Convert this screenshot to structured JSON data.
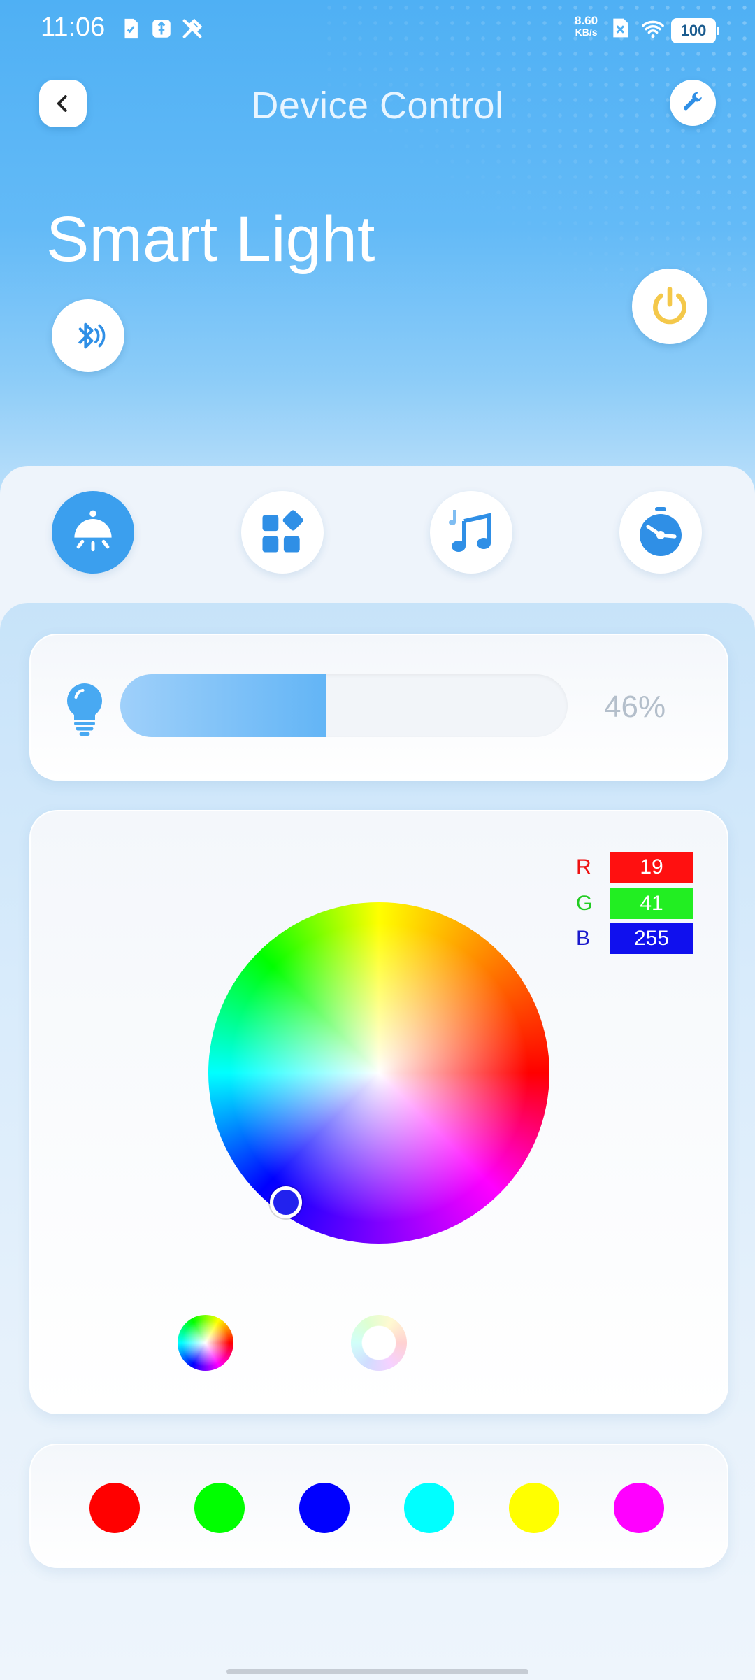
{
  "status_bar": {
    "time": "11:06",
    "net_speed_value": "8.60",
    "net_speed_unit": "KB/s",
    "battery": "100"
  },
  "header": {
    "title": "Device Control"
  },
  "device": {
    "name": "Smart Light"
  },
  "brightness": {
    "value": 46,
    "label": "46%"
  },
  "rgb": {
    "r_label": "R",
    "r_value": "19",
    "g_label": "G",
    "g_value": "41",
    "b_label": "B",
    "b_value": "255"
  },
  "presets": [
    "#ff0000",
    "#00ff00",
    "#0000ff",
    "#00ffff",
    "#ffff00",
    "#ff00ff"
  ],
  "colors": {
    "accent": "#3b9fee",
    "power": "#f4c84a",
    "selected": "#1329ff"
  }
}
